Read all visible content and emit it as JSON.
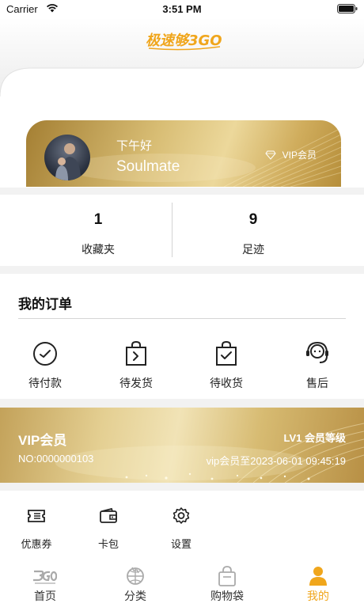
{
  "status_bar": {
    "carrier": "Carrier",
    "time": "3:51 PM"
  },
  "header": {
    "logo_text": "极速够3GO"
  },
  "profile": {
    "greeting": "下午好",
    "username": "Soulmate",
    "vip_badge": "VIP会员"
  },
  "stats": [
    {
      "value": "1",
      "label": "收藏夹"
    },
    {
      "value": "9",
      "label": "足迹"
    }
  ],
  "orders": {
    "title": "我的订单",
    "items": [
      {
        "label": "待付款",
        "icon": "clock-icon"
      },
      {
        "label": "待发货",
        "icon": "shopping-bag-arrow-icon"
      },
      {
        "label": "待收货",
        "icon": "shopping-bag-check-icon"
      },
      {
        "label": "售后",
        "icon": "customer-service-icon"
      }
    ]
  },
  "vip_card": {
    "title": "VIP会员",
    "level": "LV1 会员等级",
    "number": "NO:0000000103",
    "expiry": "vip会员至2023-06-01 09:45:19"
  },
  "tools": [
    {
      "label": "优惠券",
      "icon": "coupon-icon"
    },
    {
      "label": "卡包",
      "icon": "wallet-icon"
    },
    {
      "label": "设置",
      "icon": "gear-icon"
    }
  ],
  "tabbar": {
    "active_color": "#f0a61c",
    "tabs": [
      {
        "label": "首页",
        "icon": "3go-logo-icon",
        "active": false
      },
      {
        "label": "分类",
        "icon": "globe-icon",
        "active": false
      },
      {
        "label": "购物袋",
        "icon": "shopping-bag-icon",
        "active": false
      },
      {
        "label": "我的",
        "icon": "user-icon",
        "active": true
      }
    ]
  },
  "colors": {
    "accent": "#f0a61c",
    "gold": "#d8bd74",
    "background": "#f2f2f2"
  }
}
